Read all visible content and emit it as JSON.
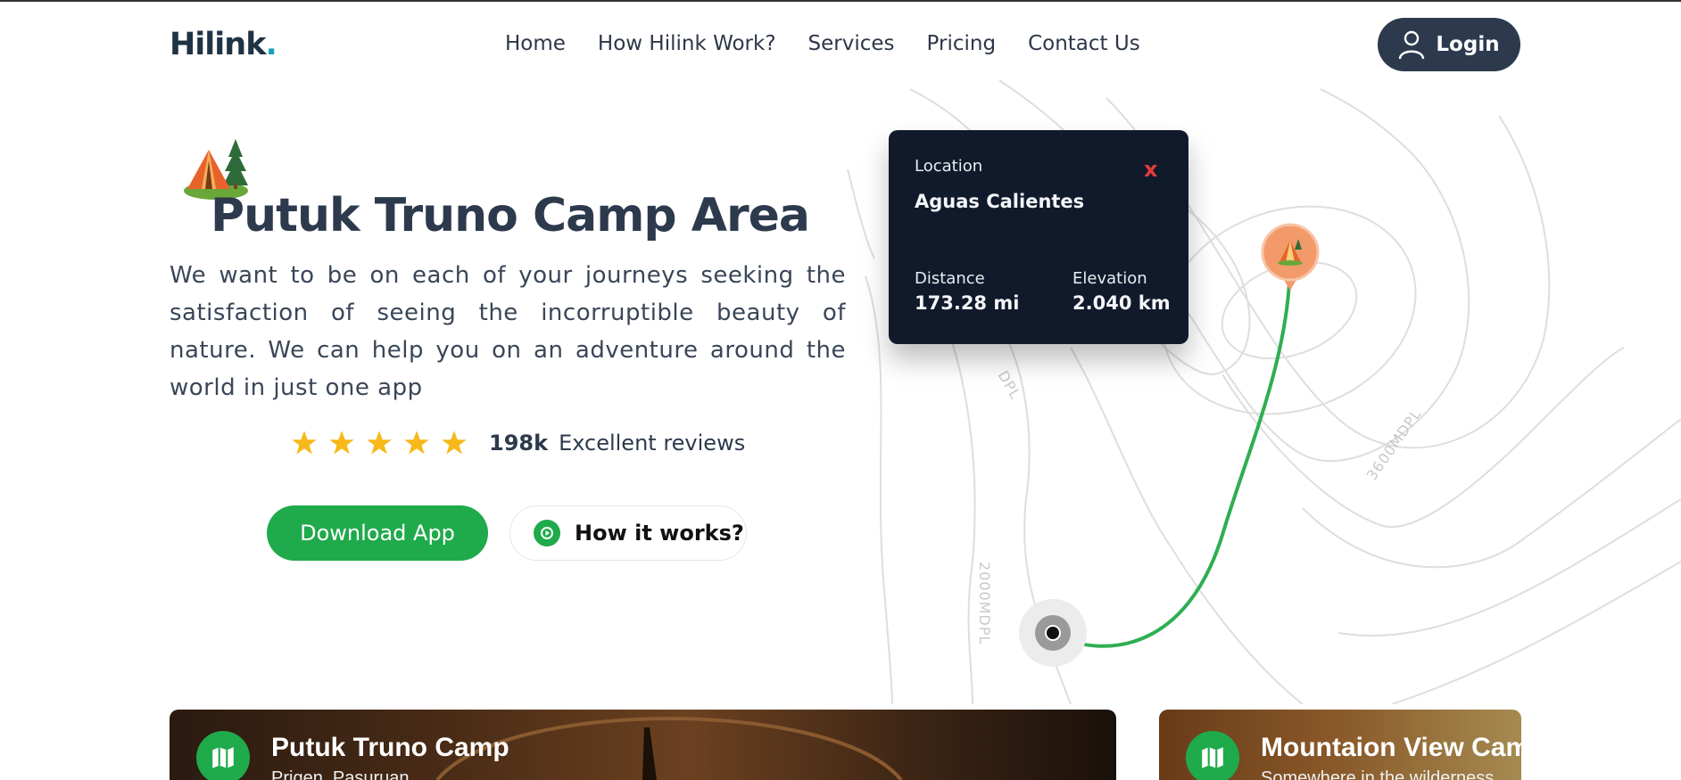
{
  "header": {
    "logo_main": "Hilink",
    "logo_dot": ".",
    "nav": [
      "Home",
      "How Hilink Work?",
      "Services",
      "Pricing",
      "Contact Us"
    ],
    "login_label": "Login"
  },
  "hero": {
    "icon": "camping-tent-icon",
    "title": "Putuk Truno Camp Area",
    "description": "We want to be on each of your journeys seeking the satisfaction of seeing the incorruptible beauty of nature. We can help you on an adventure around the world in just one app",
    "stars": 5,
    "review_count": "198k",
    "review_label": "Excellent reviews",
    "download_label": "Download App",
    "how_label": "How it works?"
  },
  "map": {
    "contour_labels": [
      "DPL",
      "3600MDPL",
      "2000MDPL"
    ],
    "route_color": "#2fae52",
    "pin_color": "#f39a6a"
  },
  "location_card": {
    "location_label": "Location",
    "location_value": "Aguas Calientes",
    "close_label": "x",
    "distance_label": "Distance",
    "distance_value": "173.28 mi",
    "elevation_label": "Elevation",
    "elevation_value": "2.040 km"
  },
  "cards": [
    {
      "title": "Putuk Truno Camp",
      "subtitle": "Prigen, Pasuruan"
    },
    {
      "title": "Mountaion View Camp",
      "subtitle": "Somewhere in the wilderness"
    }
  ],
  "colors": {
    "brand_dark": "#2d3a4d",
    "brand_accent": "#1aa0b8",
    "green": "#1faa4b",
    "star": "#f6b91a",
    "close_red": "#e53b3b"
  }
}
